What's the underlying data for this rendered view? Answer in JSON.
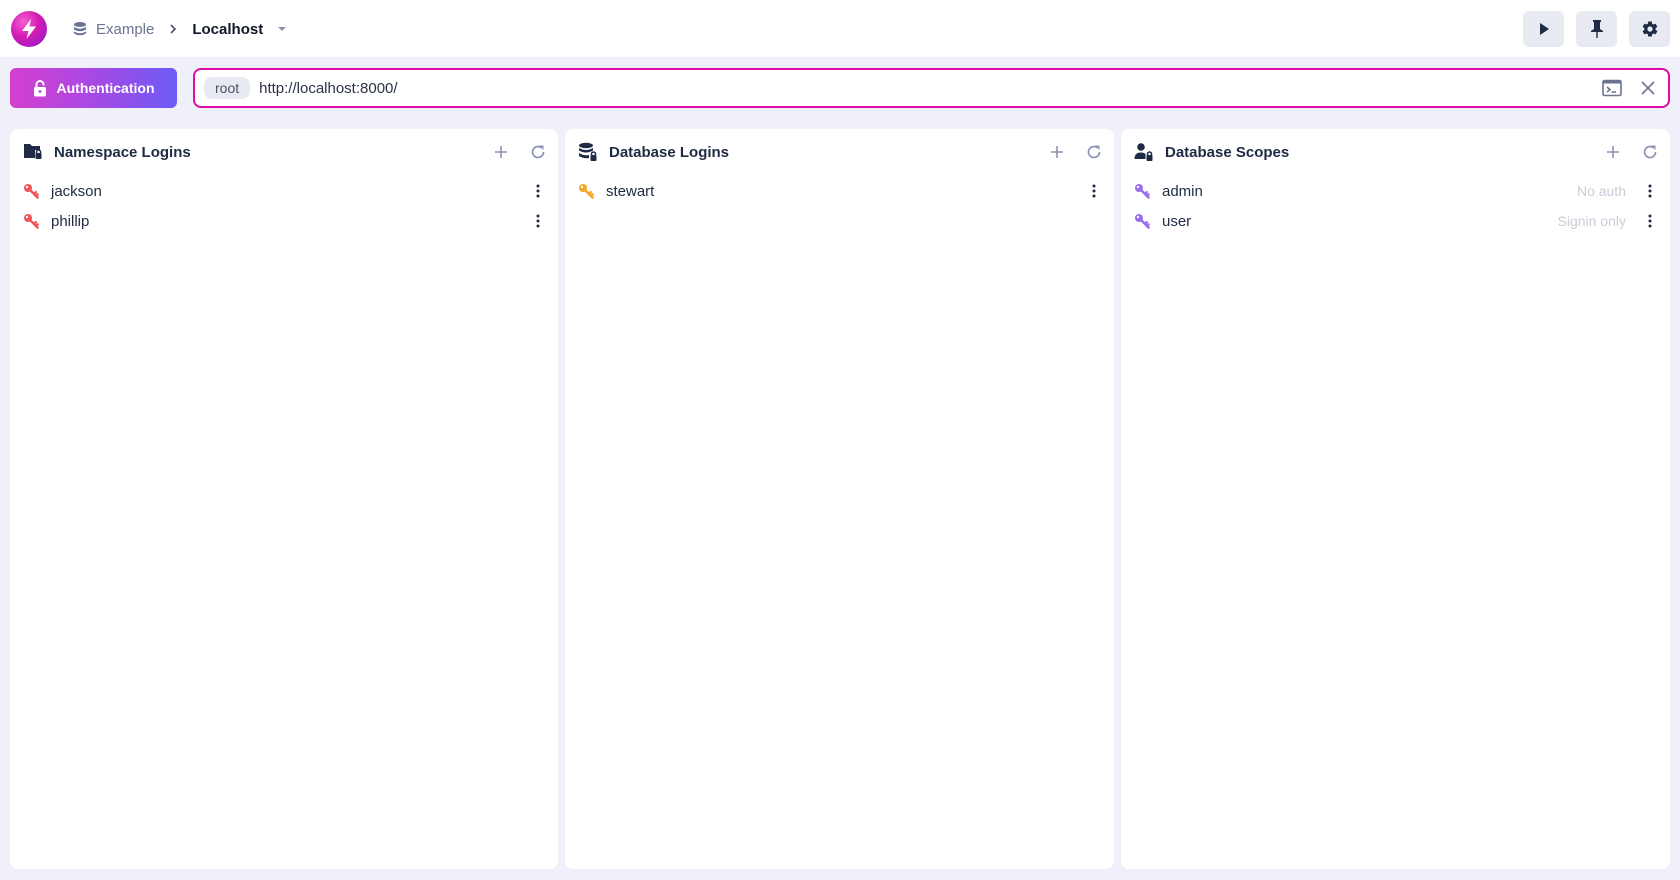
{
  "header": {
    "logo_icon": "lightning-bolt-logo",
    "breadcrumb": {
      "parent_icon": "database-icon",
      "parent": "Example",
      "separator_icon": "chevron-right-icon",
      "current": "Localhost",
      "dropdown_icon": "caret-down-icon"
    },
    "actions": [
      {
        "name": "run-query-button",
        "icon": "play-icon"
      },
      {
        "name": "pin-button",
        "icon": "pin-icon"
      },
      {
        "name": "settings-button",
        "icon": "gear-icon"
      }
    ]
  },
  "toolbar": {
    "auth_button_label": "Authentication",
    "auth_icon": "lock-open-icon",
    "connection": {
      "user_badge": "root",
      "url": "http://localhost:8000/",
      "console_icon": "terminal-icon",
      "close_icon": "close-icon"
    }
  },
  "colors": {
    "accent": "#e20aa4",
    "gradient_start": "#d53ecf",
    "gradient_end": "#6c5cf5",
    "namespace_key": "#f05454",
    "database_key": "#f5a623",
    "scope_key": "#9a6cf0"
  },
  "panels": [
    {
      "title": "Namespace Logins",
      "icon": "folder-lock-icon",
      "add_icon": "plus-icon",
      "refresh_icon": "refresh-icon",
      "items": [
        {
          "label": "jackson",
          "note": ""
        },
        {
          "label": "phillip",
          "note": ""
        }
      ]
    },
    {
      "title": "Database Logins",
      "icon": "database-lock-icon",
      "add_icon": "plus-icon",
      "refresh_icon": "refresh-icon",
      "items": [
        {
          "label": "stewart",
          "note": ""
        }
      ]
    },
    {
      "title": "Database Scopes",
      "icon": "user-lock-icon",
      "add_icon": "plus-icon",
      "refresh_icon": "refresh-icon",
      "items": [
        {
          "label": "admin",
          "note": "No auth"
        },
        {
          "label": "user",
          "note": "Signin only"
        }
      ]
    }
  ]
}
